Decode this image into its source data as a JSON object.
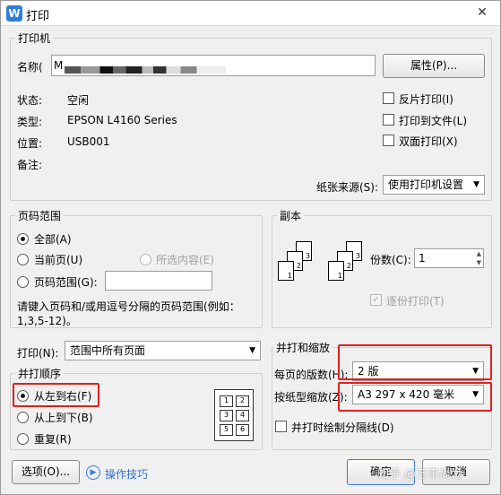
{
  "window": {
    "title": "打印",
    "app_icon": "W"
  },
  "printer": {
    "group_label": "打印机",
    "name_label": "名称(",
    "name_value": "M",
    "properties_button": "属性(P)...",
    "status_label": "状态:",
    "status_value": "空闲",
    "type_label": "类型:",
    "type_value": "EPSON L4160 Series",
    "location_label": "位置:",
    "location_value": "USB001",
    "comment_label": "备注:",
    "reverse_print": "反片打印(I)",
    "print_to_file": "打印到文件(L)",
    "duplex": "双面打印(X)",
    "paper_source_label": "纸张来源(S):",
    "paper_source_value": "使用打印机设置"
  },
  "page_range": {
    "group_label": "页码范围",
    "all": "全部(A)",
    "current": "当前页(U)",
    "selection": "所选内容(E)",
    "pages": "页码范围(G):",
    "hint": "请键入页码和/或用逗号分隔的页码范围(例如：",
    "hint_example": "1,3,5-12)。"
  },
  "copies": {
    "group_label": "副本",
    "count_label": "份数(C):",
    "count_value": "1",
    "collate": "逐份打印(T)"
  },
  "print_what": {
    "label": "打印(N):",
    "value": "范围中所有页面"
  },
  "order": {
    "group_label": "并打顺序",
    "left_to_right": "从左到右(F)",
    "top_to_bottom": "从上到下(B)",
    "repeat": "重复(R)",
    "preview_pages": [
      "1",
      "2",
      "3",
      "4",
      "5",
      "6"
    ]
  },
  "zoom": {
    "group_label": "并打和缩放",
    "pages_per_sheet_label": "每页的版数(H):",
    "pages_per_sheet_value": "2 版",
    "scale_label": "按纸型缩放(Z):",
    "scale_value": "A3 297 x 420 毫米",
    "draw_lines": "并打时绘制分隔线(D)"
  },
  "footer": {
    "options_button": "选项(O)...",
    "tips_link": "操作技巧",
    "ok_button": "确定",
    "cancel_button": "取消",
    "watermark": "知乎 @万事尚力"
  },
  "colors": {
    "highlight": "#e02020",
    "accent": "#2f7fd8"
  }
}
